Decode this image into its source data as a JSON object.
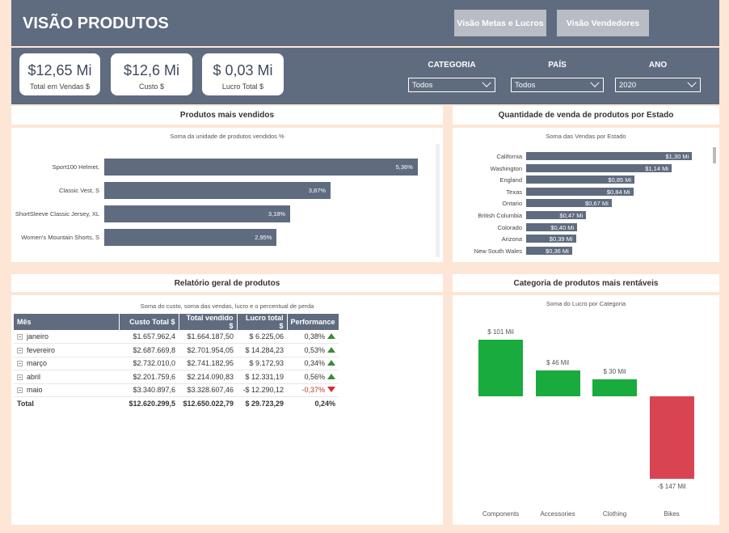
{
  "header": {
    "title": "VISÃO PRODUTOS",
    "nav1": "Visão Metas e Lucros",
    "nav2": "Visão Vendedores"
  },
  "kpis": [
    {
      "value": "$12,65 Mi",
      "label": "Total em Vendas $"
    },
    {
      "value": "$12,6 Mi",
      "label": "Custo $"
    },
    {
      "value": "$ 0,03 Mi",
      "label": "Lucro Total $"
    }
  ],
  "filters": [
    {
      "label": "CATEGORIA",
      "value": "Todos"
    },
    {
      "label": "PAÍS",
      "value": "Todos"
    },
    {
      "label": "ANO",
      "value": "2020"
    }
  ],
  "colors": {
    "header": "#5f6b7f",
    "bg": "#fde6d6",
    "green": "#1aab3e",
    "red": "#d94452",
    "bar": "#5f6b7f"
  },
  "produtos": {
    "title": "Produtos mais vendidos",
    "subtitle": "Soma da unidade de produtos vendidos %"
  },
  "estados": {
    "title": "Quantidade de venda de produtos por Estado",
    "subtitle": "Soma das Vendas por Estado"
  },
  "relatorio": {
    "title": "Relatório geral de produtos",
    "subtitle": "Soma do custo, soma das vendas, lucro e o percentual de perda",
    "columns": [
      "Mês",
      "Custo Total $",
      "Total vendido $",
      "Lucro total $",
      "Performance"
    ],
    "rows": [
      {
        "mes": "janeiro",
        "custo": "$1.657.962,4",
        "vendido": "$1.664.187,50",
        "lucro": "$ 6.225,06",
        "perf": "0,38%",
        "trend": "up"
      },
      {
        "mes": "fevereiro",
        "custo": "$2.687.669,8",
        "vendido": "$2.701.954,05",
        "lucro": "$ 14.284,23",
        "perf": "0,53%",
        "trend": "up"
      },
      {
        "mes": "março",
        "custo": "$2.732.010,0",
        "vendido": "$2.741.182,95",
        "lucro": "$ 9.172,93",
        "perf": "0,34%",
        "trend": "up"
      },
      {
        "mes": "abril",
        "custo": "$2.201.759,6",
        "vendido": "$2.214.090,83",
        "lucro": "$ 12.331,19",
        "perf": "0,56%",
        "trend": "up"
      },
      {
        "mes": "maio",
        "custo": "$3.340.897,6",
        "vendido": "$3.328.607,46",
        "lucro": "-$ 12.290,12",
        "perf": "-0,37%",
        "trend": "down"
      }
    ],
    "total": {
      "mes": "Total",
      "custo": "$12.620.299,5",
      "vendido": "$12.650.022,79",
      "lucro": "$ 29.723,29",
      "perf": "0,24%"
    }
  },
  "categoria": {
    "title": "Categoria de produtos mais rentáveis",
    "subtitle": "Soma do Lucro por Categoria"
  },
  "chart_data": [
    {
      "type": "bar",
      "orientation": "horizontal",
      "title": "Produtos mais vendidos",
      "subtitle": "Soma da unidade de produtos vendidos %",
      "categories": [
        "Sport100 Helmet,",
        "Classic Vest, S",
        "ShortSleeve Classic Jersey, XL",
        "Women's Mountain Shorts, S"
      ],
      "values": [
        5.36,
        3.87,
        3.18,
        2.95
      ],
      "labels": [
        "5,36%",
        "3,87%",
        "3,18%",
        "2,95%"
      ],
      "xlim": [
        0,
        5.5
      ]
    },
    {
      "type": "bar",
      "orientation": "horizontal",
      "title": "Quantidade de venda de produtos por Estado",
      "subtitle": "Soma das Vendas por Estado",
      "categories": [
        "California",
        "Washington",
        "England",
        "Texas",
        "Ontario",
        "British Columbia",
        "Colorado",
        "Arizona",
        "New South Wales"
      ],
      "values": [
        1.3,
        1.14,
        0.85,
        0.84,
        0.67,
        0.47,
        0.4,
        0.39,
        0.36
      ],
      "labels": [
        "$1,30 Mi",
        "$1,14 Mi",
        "$0,85 Mi",
        "$0,84 Mi",
        "$0,67 Mi",
        "$0,47 Mi",
        "$0,40 Mi",
        "$0,39 Mi",
        "$0,36 Mi"
      ],
      "xlim": [
        0,
        1.33
      ]
    },
    {
      "type": "bar",
      "title": "Categoria de produtos mais rentáveis",
      "subtitle": "Soma do Lucro por Categoria",
      "categories": [
        "Components",
        "Accessories",
        "Clothing",
        "Bikes"
      ],
      "values": [
        101,
        46,
        30,
        -147
      ],
      "labels": [
        "$ 101 Mil",
        "$ 46 Mil",
        "$ 30 Mil",
        "-$ 147 Mil"
      ],
      "colors": [
        "#1aab3e",
        "#1aab3e",
        "#1aab3e",
        "#d94452"
      ],
      "ylim": [
        -147,
        101
      ]
    }
  ]
}
